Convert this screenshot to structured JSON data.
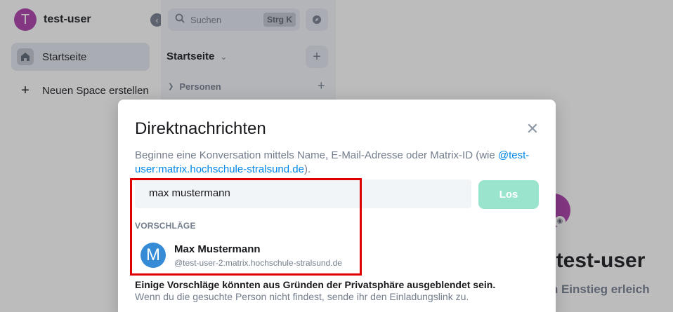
{
  "user": {
    "initial": "T",
    "name": "test-user"
  },
  "spaces": {
    "home_label": "Startseite",
    "new_space_label": "Neuen Space erstellen"
  },
  "room_list": {
    "search_placeholder": "Suchen",
    "search_shortcut": "Strg K",
    "header_title": "Startseite",
    "section_people": "Personen"
  },
  "home": {
    "welcome_title": "n test-user",
    "welcome_subtitle": "den Einstieg erleich"
  },
  "dialog": {
    "title": "Direktnachrichten",
    "description_prefix": "Beginne eine Konversation mittels Name, E-Mail-Adresse oder Matrix-ID (wie ",
    "description_link": "@test-user:matrix.hochschule-stralsund.de",
    "description_suffix": ").",
    "search_value": "max mustermann",
    "go_label": "Los",
    "suggestions_heading": "VORSCHLÄGE",
    "suggestions": [
      {
        "initial": "M",
        "name": "Max Mustermann",
        "id": "@test-user-2:matrix.hochschule-stralsund.de"
      }
    ],
    "privacy_note": "Einige Vorschläge könnten aus Gründen der Privatsphäre ausgeblendet sein.",
    "invite_note": "Wenn du die gesuchte Person nicht findest, sende ihr den Einladungslink zu."
  },
  "colors": {
    "accent": "#0dbd8b",
    "go_button_disabled": "#9ae4cd",
    "link": "#0086e6",
    "user_avatar": "#ac3ba8",
    "suggestion_avatar": "#368bd6",
    "highlight": "#e00000"
  },
  "icons": {
    "collapse": "chevron-left-icon",
    "home": "home-icon",
    "plus": "plus-icon",
    "search": "search-icon",
    "explore": "compass-icon",
    "close": "close-icon",
    "camera": "camera-icon"
  }
}
